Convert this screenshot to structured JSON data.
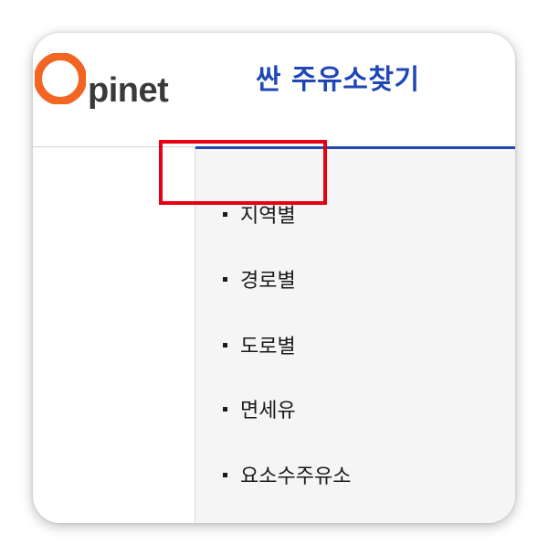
{
  "logo": {
    "letter": "O",
    "text": "pinet",
    "accent_color": "#f26522"
  },
  "header": {
    "title": "싼 주유소찾기",
    "title_color": "#1f47b5"
  },
  "menu": {
    "items": [
      {
        "label": "지역별",
        "highlighted": true
      },
      {
        "label": "경로별",
        "highlighted": false
      },
      {
        "label": "도로별",
        "highlighted": false
      },
      {
        "label": "면세유",
        "highlighted": false
      },
      {
        "label": "요소수주유소",
        "highlighted": false
      }
    ]
  },
  "colors": {
    "highlight_border": "#e60012",
    "menu_background": "#f5f5f5"
  }
}
